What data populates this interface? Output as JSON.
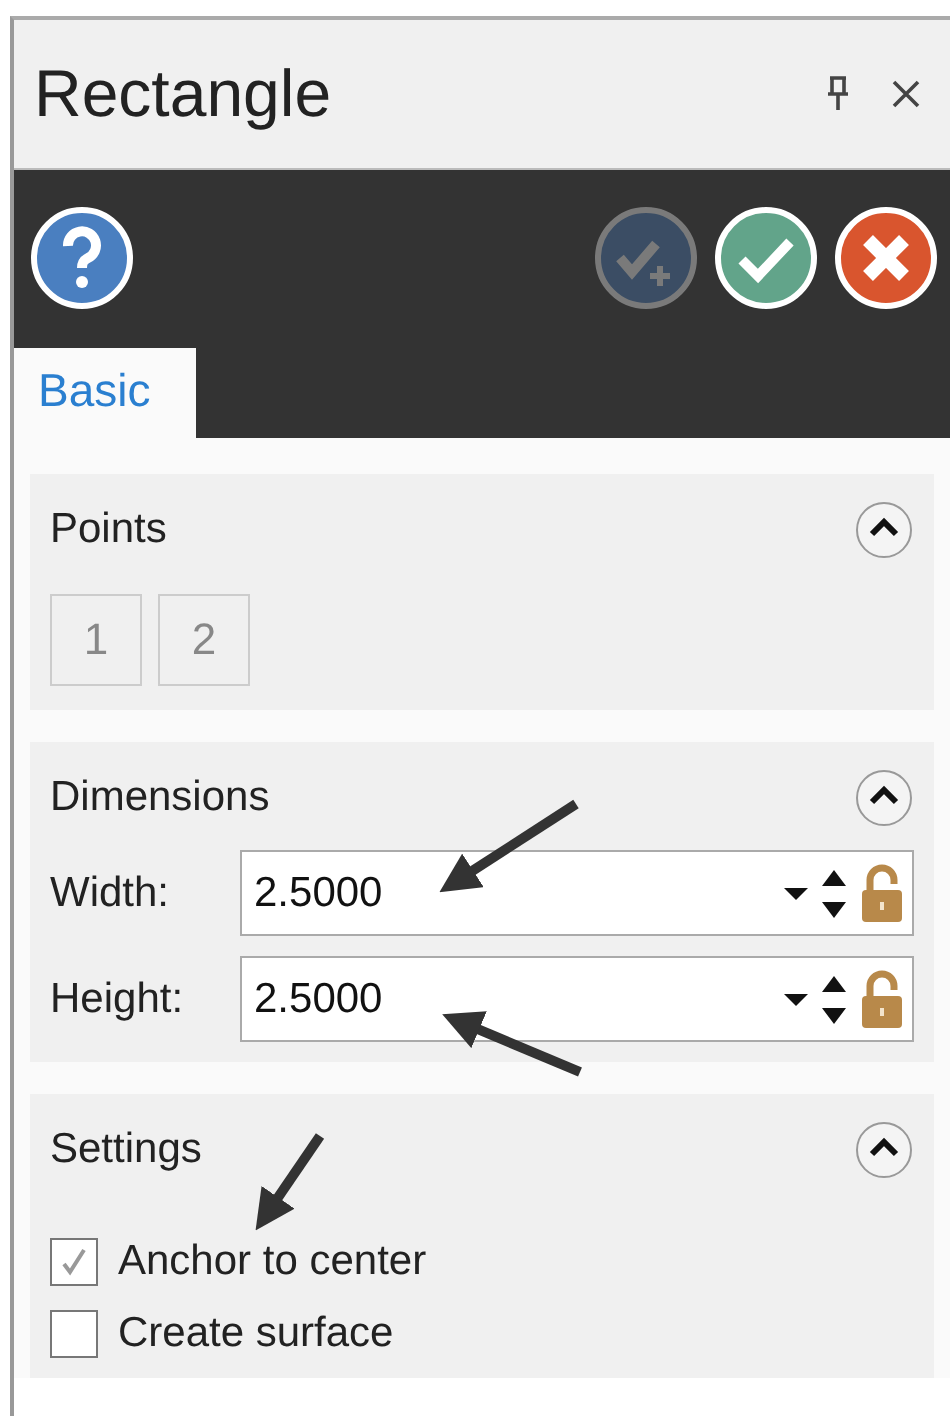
{
  "window": {
    "title": "Rectangle"
  },
  "toolbar": [
    {
      "kind": "help",
      "disabled": false
    },
    {
      "kind": "apply",
      "disabled": true
    },
    {
      "kind": "ok",
      "disabled": false
    },
    {
      "kind": "cancel",
      "disabled": false
    }
  ],
  "tabs": [
    {
      "label": "Basic",
      "selected": true
    }
  ],
  "sections": [
    {
      "kind": "points",
      "title": "Points",
      "expanded": true,
      "points": [
        "1",
        "2"
      ]
    },
    {
      "kind": "fields",
      "title": "Dimensions",
      "expanded": true,
      "fields": [
        {
          "label": "Width:",
          "value": "2.5000",
          "locked": false
        },
        {
          "label": "Height:",
          "value": "2.5000",
          "locked": false
        }
      ]
    },
    {
      "kind": "checks",
      "title": "Settings",
      "expanded": true,
      "options": [
        {
          "label": "Anchor to center",
          "checked": true
        },
        {
          "label": "Create surface",
          "checked": false
        }
      ]
    }
  ]
}
